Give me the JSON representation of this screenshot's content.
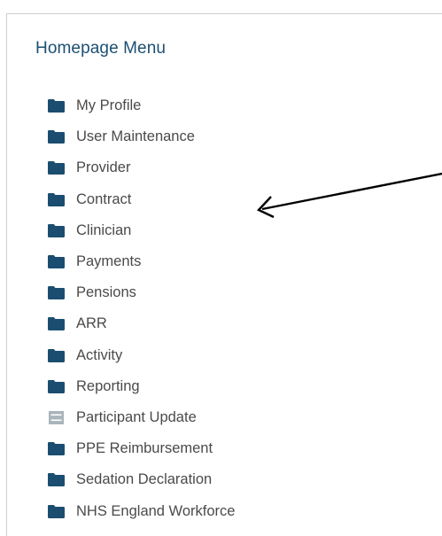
{
  "menu": {
    "title": "Homepage Menu",
    "items": [
      {
        "label": "My Profile",
        "icon": "folder-icon"
      },
      {
        "label": "User Maintenance",
        "icon": "folder-icon"
      },
      {
        "label": "Provider",
        "icon": "folder-icon"
      },
      {
        "label": "Contract",
        "icon": "folder-icon"
      },
      {
        "label": "Clinician",
        "icon": "folder-icon"
      },
      {
        "label": "Payments",
        "icon": "folder-icon"
      },
      {
        "label": "Pensions",
        "icon": "folder-icon"
      },
      {
        "label": "ARR",
        "icon": "folder-icon"
      },
      {
        "label": "Activity",
        "icon": "folder-icon"
      },
      {
        "label": "Reporting",
        "icon": "folder-icon"
      },
      {
        "label": "Participant Update",
        "icon": "form-icon"
      },
      {
        "label": "PPE Reimbursement",
        "icon": "folder-icon"
      },
      {
        "label": "Sedation Declaration",
        "icon": "folder-icon"
      },
      {
        "label": "NHS England Workforce",
        "icon": "folder-icon"
      }
    ]
  },
  "colors": {
    "title": "#1c4f72",
    "folder_icon": "#1b4d70",
    "form_icon": "#aab4bb",
    "item_text": "#4a4a4a",
    "arrow": "#000000"
  }
}
